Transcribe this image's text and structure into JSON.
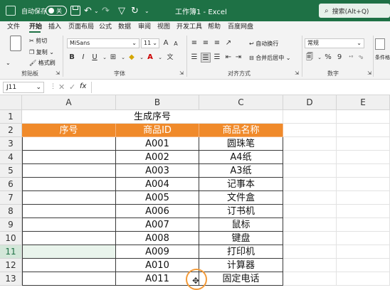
{
  "titlebar": {
    "autosave_label": "自动保存",
    "autosave_state": "关",
    "document_title": "工作簿1 - Excel",
    "search_placeholder": "搜索(Alt+Q)"
  },
  "menu": [
    "文件",
    "开始",
    "插入",
    "页面布局",
    "公式",
    "数据",
    "审阅",
    "视图",
    "开发工具",
    "帮助",
    "百度网盘"
  ],
  "ribbon": {
    "clipboard": {
      "cut": "剪切",
      "copy": "复制",
      "format_painter": "格式刷",
      "group_label": "剪贴板"
    },
    "font": {
      "font_name": "MiSans",
      "font_size": "11",
      "bold": "B",
      "italic": "I",
      "underline": "U",
      "grow": "A",
      "shrink": "A",
      "wen": "文",
      "group_label": "字体"
    },
    "alignment": {
      "wrap_text": "自动换行",
      "merge_center": "合并后居中",
      "group_label": "对齐方式"
    },
    "number": {
      "format": "常规",
      "group_label": "数字"
    },
    "cond_format_label": "条件格"
  },
  "formula_bar": {
    "name_box": "J11",
    "fx": "fx",
    "content": ""
  },
  "columns": [
    "A",
    "B",
    "C",
    "D",
    "E"
  ],
  "rows": [
    "1",
    "2",
    "3",
    "4",
    "5",
    "6",
    "7",
    "8",
    "9",
    "10",
    "11",
    "12",
    "13"
  ],
  "sheet": {
    "title": "生成序号",
    "headers": [
      "序号",
      "商品ID",
      "商品名称"
    ],
    "data": [
      [
        "",
        "A001",
        "圆珠笔"
      ],
      [
        "",
        "A002",
        "A4纸"
      ],
      [
        "",
        "A003",
        "A3纸"
      ],
      [
        "",
        "A004",
        "记事本"
      ],
      [
        "",
        "A005",
        "文件盒"
      ],
      [
        "",
        "A006",
        "订书机"
      ],
      [
        "",
        "A007",
        "鼠标"
      ],
      [
        "",
        "A008",
        "键盘"
      ],
      [
        "",
        "A009",
        "打印机"
      ],
      [
        "",
        "A010",
        "计算器"
      ],
      [
        "",
        "A011",
        "固定电话"
      ]
    ]
  },
  "colors": {
    "title_bar": "#1e7145",
    "header_fill": "#f08a2a",
    "cursor_ring": "#f39a38"
  }
}
